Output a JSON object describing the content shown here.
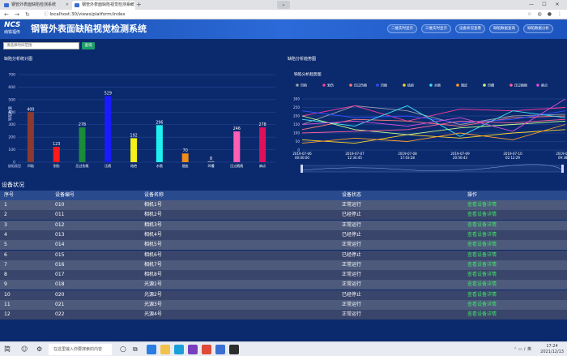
{
  "browser": {
    "tabs": [
      {
        "title": "钢管外表面缺陷检测系统"
      },
      {
        "title": "钢管外表面缺陷视觉检测系统"
      }
    ],
    "url": "localhost:30/views/platform/index"
  },
  "header": {
    "logo_top": "NCS",
    "logo_bottom": "纳铁福传",
    "title": "钢管外表面缺陷视觉检测系统",
    "buttons": [
      "二维实时显示",
      "三维实时显示",
      "设备状况查看",
      "缺陷数据查询",
      "缺陷数据分析"
    ]
  },
  "search": {
    "placeholder": "请选择时间范围",
    "button": "查询"
  },
  "bar_panel": {
    "title": "缺陷分析统计图"
  },
  "trend_panel": {
    "title": "缺陷分析趋势图",
    "chart_title": "缺陷分析趋势图"
  },
  "chart_data": [
    {
      "type": "bar",
      "title": "",
      "ylabel": "缺陷数量",
      "xlabel": "缺陷类型",
      "ylim": [
        0,
        700
      ],
      "yticks": [
        0,
        100,
        200,
        300,
        400,
        500,
        600,
        700
      ],
      "categories": [
        "凹陷",
        "划伤",
        "压过伤痕",
        "压痕",
        "结疤",
        "水痕",
        "翘皮",
        "凹槽",
        "压过痕痕",
        "麻点"
      ],
      "values": [
        400,
        123,
        278,
        529,
        192,
        296,
        70,
        8,
        246,
        278
      ],
      "colors": [
        "#8b3a2f",
        "#ff1a1a",
        "#1b8a3a",
        "#1a1aff",
        "#f5ef1a",
        "#1ef0f0",
        "#f08c1a",
        "#8892a6",
        "#ff5fb4",
        "#e0105a"
      ],
      "grid": true
    },
    {
      "type": "line",
      "title": "缺陷分析趋势图",
      "ylim": [
        0,
        300
      ],
      "yticks": [
        0,
        50,
        100,
        150,
        200,
        250,
        300
      ],
      "x": [
        "2019-07-06\n00:00:00",
        "2019-07-07\n12:34:45",
        "2019-07-08\n17:03:28",
        "2019-07-09\n20:56:43",
        "2019-07-10\n02:12:29",
        "2019-07-11\n09:38:38"
      ],
      "legend_position": "top",
      "series": [
        {
          "name": "凹陷",
          "color": "#9aa0a8",
          "values": [
            150,
            260,
            230,
            150,
            200,
            210
          ]
        },
        {
          "name": "划伤",
          "color": "#ff3b9a",
          "values": [
            200,
            260,
            170,
            240,
            230,
            250
          ]
        },
        {
          "name": "压过伤痕",
          "color": "#ff7a7a",
          "values": [
            120,
            180,
            170,
            140,
            190,
            200
          ]
        },
        {
          "name": "凹痕",
          "color": "#3050ff",
          "values": [
            230,
            190,
            200,
            160,
            180,
            230
          ]
        },
        {
          "name": "结疤",
          "color": "#ffd52a",
          "values": [
            60,
            40,
            90,
            70,
            100,
            120
          ]
        },
        {
          "name": "水痕",
          "color": "#40e0f0",
          "values": [
            180,
            140,
            260,
            80,
            230,
            190
          ]
        },
        {
          "name": "翘皮",
          "color": "#ff9f2a",
          "values": [
            40,
            70,
            50,
            100,
            60,
            150
          ]
        },
        {
          "name": "凹槽",
          "color": "#c7ff8a",
          "values": [
            200,
            120,
            90,
            130,
            150,
            170
          ]
        },
        {
          "name": "压过痕痕",
          "color": "#ff5f9f",
          "values": [
            100,
            110,
            120,
            170,
            160,
            180
          ]
        },
        {
          "name": "麻点",
          "color": "#d94fd9",
          "values": [
            150,
            170,
            140,
            190,
            110,
            300
          ]
        }
      ]
    }
  ],
  "devices": {
    "title": "设备状况",
    "columns": [
      "序号",
      "设备编号",
      "设备名称",
      "设备状态",
      "操作"
    ],
    "rows": [
      [
        "1",
        "010",
        "相机1号",
        "正常运行",
        "查看设备详情"
      ],
      [
        "2",
        "011",
        "相机2号",
        "已经停止",
        "查看设备详情"
      ],
      [
        "3",
        "012",
        "相机3号",
        "正常运行",
        "查看设备详情"
      ],
      [
        "4",
        "013",
        "相机4号",
        "已经停止",
        "查看设备详情"
      ],
      [
        "5",
        "014",
        "相机5号",
        "正常运行",
        "查看设备详情"
      ],
      [
        "6",
        "015",
        "相机6号",
        "已经停止",
        "查看设备详情"
      ],
      [
        "7",
        "016",
        "相机7号",
        "正常运行",
        "查看设备详情"
      ],
      [
        "8",
        "017",
        "相机8号",
        "正常运行",
        "查看设备详情"
      ],
      [
        "9",
        "018",
        "光源1号",
        "正常运行",
        "查看设备详情"
      ],
      [
        "10",
        "020",
        "光源2号",
        "已经停止",
        "查看设备详情"
      ],
      [
        "11",
        "021",
        "光源3号",
        "正常运行",
        "查看设备详情"
      ],
      [
        "12",
        "022",
        "光源4号",
        "正常运行",
        "查看设备详情"
      ]
    ]
  },
  "taskbar": {
    "search_placeholder": "在这里输入你要搜索的内容",
    "ime": "简",
    "time": "17:24",
    "date": "2021/12/13"
  }
}
